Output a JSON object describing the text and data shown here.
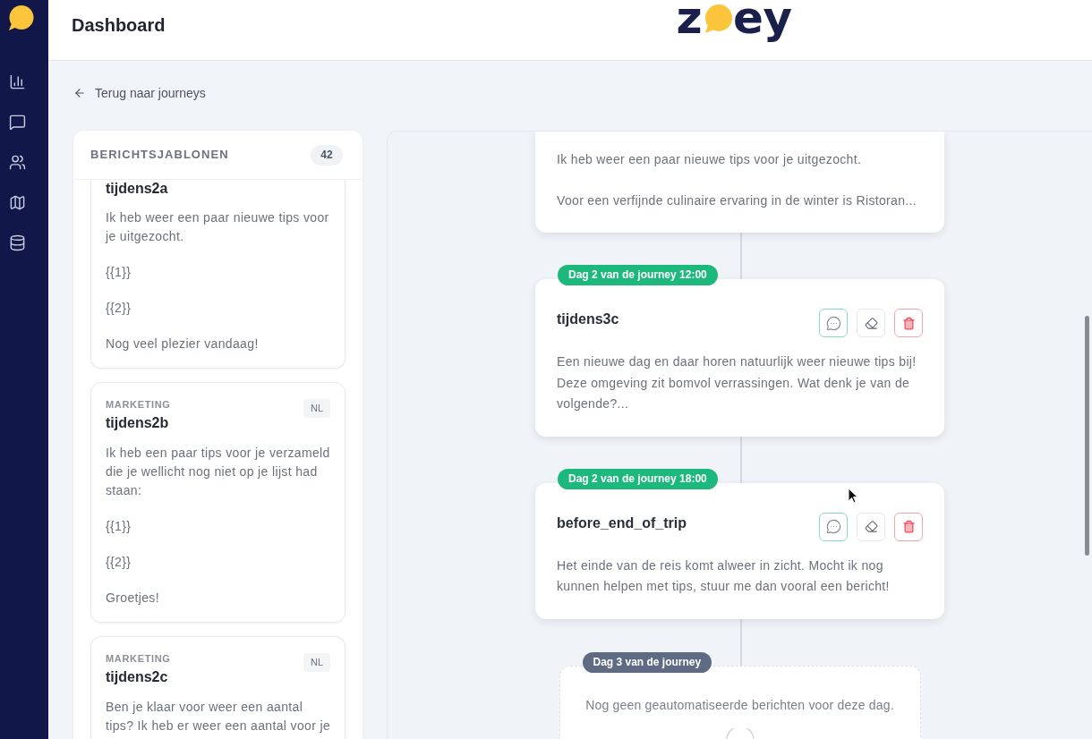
{
  "header": {
    "title": "Dashboard",
    "logo": {
      "lead": "z",
      "tail": "ey"
    }
  },
  "back_link": {
    "label": "Terug naar journeys"
  },
  "templates": {
    "title": "BERICHTSJABLONEN",
    "count": "42",
    "items": [
      {
        "name": "tijdens2a",
        "body": [
          "Ik heb weer een paar nieuwe tips voor je uitgezocht.",
          "{{1}}",
          "{{2}}",
          "Nog veel plezier vandaag!"
        ]
      },
      {
        "category": "MARKETING",
        "language": "NL",
        "name": "tijdens2b",
        "body": [
          "Ik heb een paar tips voor je verzameld die je wellicht nog niet op je lijst had staan:",
          "{{1}}",
          "{{2}}",
          "Groetjes!"
        ]
      },
      {
        "category": "MARKETING",
        "language": "NL",
        "name": "tijdens2c",
        "body": [
          "Ben je klaar voor weer een aantal tips? Ik heb er weer een aantal voor je"
        ]
      }
    ]
  },
  "timeline": [
    {
      "kind": "message",
      "body": [
        "Ik heb weer een paar nieuwe tips voor je uitgezocht.",
        "Voor een verfijnde culinaire ervaring in de winter is Ristoran..."
      ]
    },
    {
      "kind": "message",
      "day": "Dag 2 van de journey 12:00",
      "color": "#1db87c",
      "title": "tijdens3c",
      "body": [
        "Een nieuwe dag en daar horen natuurlijk weer nieuwe tips bij! Deze omgeving zit bomvol verrassingen. Wat denk je van de volgende?..."
      ]
    },
    {
      "kind": "message",
      "day": "Dag 2 van de journey 18:00",
      "color": "#1db87c",
      "title": "before_end_of_trip",
      "body": [
        "Het einde van de reis komt alweer in zicht. Mocht ik nog kunnen helpen met tips, stuur me dan vooral een bericht!"
      ]
    },
    {
      "kind": "empty",
      "day": "Dag 3 van de journey",
      "color": "#5e6b82",
      "message": "Nog geen geautomatiseerde berichten voor deze dag."
    }
  ]
}
